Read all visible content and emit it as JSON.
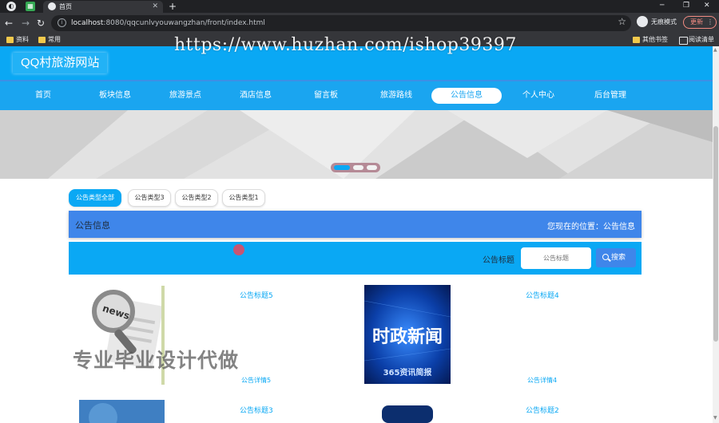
{
  "browser": {
    "tab_title": "首页",
    "url_host": "localhost",
    "url_rest": ":8080/qqcunlvyouwangzhan/front/index.html",
    "incognito_label": "无痕模式",
    "update_label": "更新",
    "bookmarks": [
      "资料",
      "常用"
    ],
    "bookmarks_right": [
      "其他书签",
      "阅读清单"
    ]
  },
  "watermark": {
    "url": "https://www.huzhan.com/ishop39397",
    "text": "专业毕业设计代做"
  },
  "site": {
    "logo": "QQ村旅游网站",
    "nav": [
      "首页",
      "板块信息",
      "旅游景点",
      "酒店信息",
      "留言板",
      "旅游路线",
      "公告信息",
      "个人中心",
      "后台管理"
    ],
    "nav_active_index": 6
  },
  "carousel": {
    "slide_count": 3,
    "active_index": 0
  },
  "filters": [
    "公告类型全部",
    "公告类型3",
    "公告类型2",
    "公告类型1"
  ],
  "filter_active_index": 0,
  "section": {
    "title": "公告信息",
    "breadcrumb": "您现在的位置：公告信息"
  },
  "search": {
    "label": "公告标题",
    "placeholder": "公告标题",
    "button": "搜索"
  },
  "cards": [
    {
      "title": "公告标题5",
      "detail": "公告详情5",
      "image_text": "news"
    },
    {
      "title": "公告标题4",
      "detail": "公告详情4",
      "image_text": "时政新闻",
      "image_subtext": "365资讯简报"
    },
    {
      "title": "公告标题3",
      "detail": ""
    },
    {
      "title": "公告标题2",
      "detail": ""
    }
  ],
  "colors": {
    "primary": "#0aa8f4",
    "nav_blue": "#1aa5f0",
    "section_blue": "#3f86ea",
    "browser_dark": "#202124"
  }
}
